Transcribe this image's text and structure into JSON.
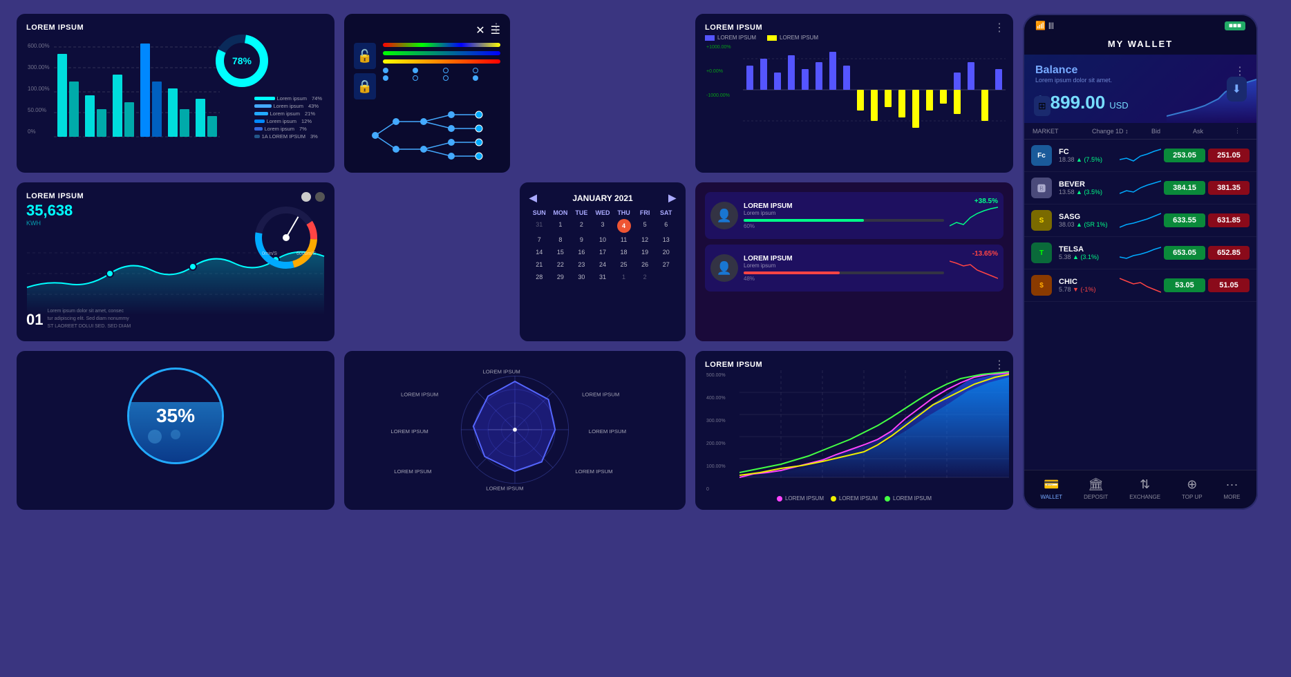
{
  "page": {
    "background": "#3a3580"
  },
  "panel1": {
    "title": "LOREM IPSUM",
    "yLabels": [
      "600.00%",
      "300.00%",
      "100.00%",
      "50.00%",
      "0%"
    ],
    "legendItems": [
      {
        "label": "Lorem ipsum",
        "pct": "74%",
        "color": "#0ff"
      },
      {
        "label": "Lorem ipsum",
        "pct": "43%",
        "color": "#4af"
      },
      {
        "label": "Lorem ipsum",
        "pct": "21%",
        "color": "#2af"
      },
      {
        "label": "Lorem ipsum",
        "pct": "12%",
        "color": "#08f"
      },
      {
        "label": "Lorem ipsum",
        "pct": "7%",
        "color": "#36d"
      },
      {
        "label": "1A LOREM IPSUM",
        "pct": "3%",
        "color": "#258"
      }
    ],
    "donut": {
      "percent": "78%",
      "color": "#0ff"
    }
  },
  "panel_calendar": {
    "month": "JANUARY 2021",
    "dayHeaders": [
      "SUN",
      "MON",
      "TUE",
      "WED",
      "THU",
      "FRI",
      "SAT"
    ],
    "days": [
      [
        "31",
        "1",
        "2",
        "3",
        "4",
        "5",
        "6"
      ],
      [
        "7",
        "8",
        "9",
        "10",
        "11",
        "12",
        "13"
      ],
      [
        "14",
        "15",
        "16",
        "17",
        "18",
        "19",
        "20"
      ],
      [
        "21",
        "22",
        "23",
        "24",
        "25",
        "26",
        "27"
      ],
      [
        "28",
        "29",
        "30",
        "31",
        "1",
        "2",
        ""
      ]
    ],
    "today": "4"
  },
  "panel_line": {
    "title": "LOREM IPSUM",
    "value": "35,638",
    "unit": "KWH"
  },
  "panel_bar2": {
    "title": "LOREM IPSUM",
    "subtitle1": "LOREM IPSUM",
    "subtitle2": "LOREM IPSUM",
    "yLabels": [
      "+1000.00%",
      "+0.00%",
      "-1000.00%"
    ]
  },
  "panel_profiles": {
    "cards": [
      {
        "name": "LOREM IPSUM",
        "sub": "Lorem ipsum",
        "stat": "+38.5%",
        "progress": 60,
        "statColor": "green"
      },
      {
        "name": "LOREM IPSUM",
        "sub": "Lorem ipsum",
        "stat": "-13.65%",
        "progress": 48,
        "statColor": "red"
      }
    ]
  },
  "panel_water": {
    "percent": "35%"
  },
  "panel_radar": {
    "labels": [
      "LOREM IPSUM",
      "LOREM IPSUM",
      "LOREM IPSUM",
      "LOREM IPSUM",
      "LOREM IPSUM",
      "LOREM IPSUM",
      "LOREM IPSUM",
      "LOREM IPSUM"
    ]
  },
  "panel_large_line": {
    "title": "LOREM IPSUM",
    "yLabels": [
      "500.00%",
      "400.00%",
      "300.00%",
      "200.00%",
      "100.00%",
      "0"
    ],
    "legend": [
      {
        "label": "LOREM IPSUM",
        "color": "#f0f"
      },
      {
        "label": "LOREM IPSUM",
        "color": "#ff0"
      },
      {
        "label": "LOREM IPSUM",
        "color": "#0f0"
      }
    ]
  },
  "phone": {
    "title": "MY WALLET",
    "signal": "WiFi/Signal",
    "battery": "■■",
    "balance": {
      "label": "Balance",
      "sublabel": "Lorem ipsum dolor sit amet.",
      "amount": "8,899.00",
      "currency": "USD"
    },
    "marketHeader": {
      "col1": "MARKET",
      "col2": "Change 1D ↕",
      "col3": "Bid",
      "col4": "Ask"
    },
    "stocks": [
      {
        "name": "FC",
        "sub1": "18.38",
        "sub2": "▲ (7.5%)",
        "color": "#1a6aaa",
        "iconText": "Fc",
        "bid": "253.05",
        "ask": "251.05",
        "chartColor": "#0af"
      },
      {
        "name": "BEVER",
        "sub1": "13.58",
        "sub2": "▲ (3.5%)",
        "color": "#4a4a6a",
        "iconText": "B",
        "bid": "384.15",
        "ask": "381.35",
        "chartColor": "#0af"
      },
      {
        "name": "SASG",
        "sub1": "38.03",
        "sub2": "▲ (SR 1%)",
        "color": "#6a5a00",
        "iconText": "S",
        "bid": "633.55",
        "ask": "631.85",
        "chartColor": "#0af"
      },
      {
        "name": "TELSA",
        "sub1": "5.38",
        "sub2": "▲ (3.1%)",
        "color": "#0a6a3a",
        "iconText": "T",
        "bid": "653.05",
        "ask": "652.85",
        "chartColor": "#0af"
      },
      {
        "name": "CHIC",
        "sub1": "5.78",
        "sub2": "▼ (-.%)",
        "color": "#6a3a00",
        "iconText": "$",
        "bid": "53.05",
        "ask": "51.05",
        "chartColor": "#f44"
      }
    ],
    "nav": [
      {
        "label": "WALLET",
        "icon": "💳",
        "active": true
      },
      {
        "label": "DEPOSIT",
        "icon": "🏦",
        "active": false
      },
      {
        "label": "EXCHANGE",
        "icon": "↕",
        "active": false
      },
      {
        "label": "TOP UP",
        "icon": "⊕",
        "active": false
      },
      {
        "label": "MORE",
        "icon": "···",
        "active": false
      }
    ]
  }
}
